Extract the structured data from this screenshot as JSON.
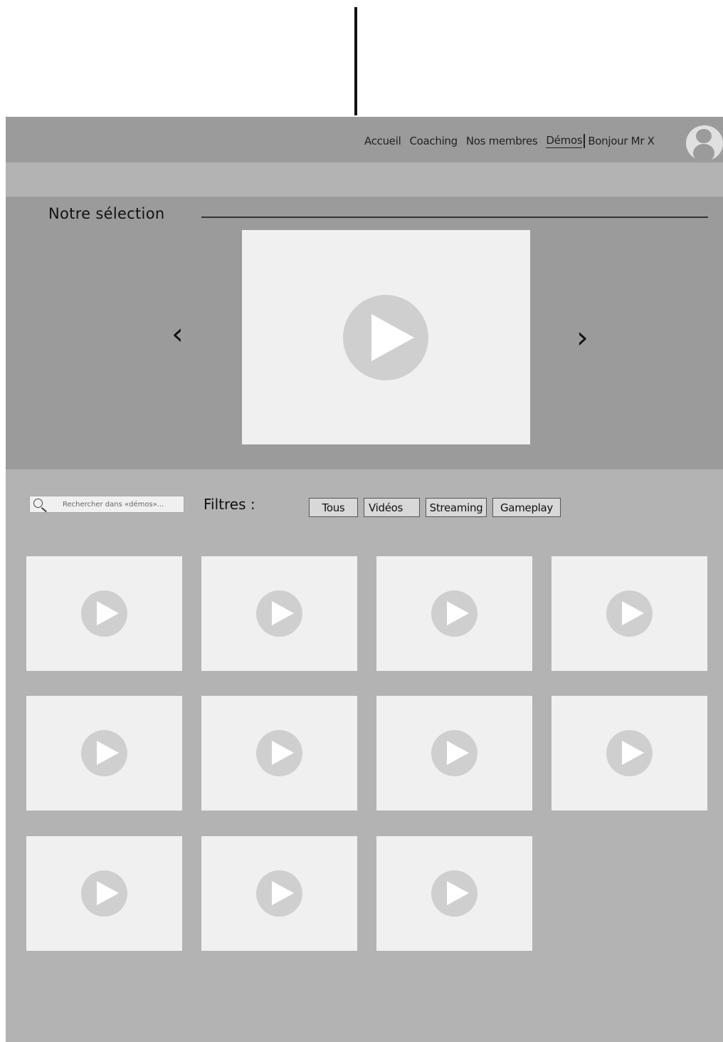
{
  "nav": {
    "items": [
      "Accueil",
      "Coaching",
      "Nos membres"
    ],
    "active": "Démos",
    "greeting": "Bonjour Mr X"
  },
  "selection": {
    "title": "Notre sélection",
    "prev_icon": "chevron-left-icon",
    "next_icon": "chevron-right-icon",
    "prev_glyph": "‹",
    "next_glyph": "›"
  },
  "search": {
    "placeholder": "Rechercher dans «démos»..."
  },
  "filters": {
    "label": "Filtres :",
    "options": [
      "Tous",
      "Vidéos",
      "Streaming",
      "Gameplay"
    ]
  },
  "videos": {
    "count_rows": [
      4,
      4,
      3
    ]
  },
  "colors": {
    "header": "#9b9b9b",
    "background": "#b3b3b3",
    "card": "#f0f0f0",
    "play": "#cfcfcf"
  }
}
